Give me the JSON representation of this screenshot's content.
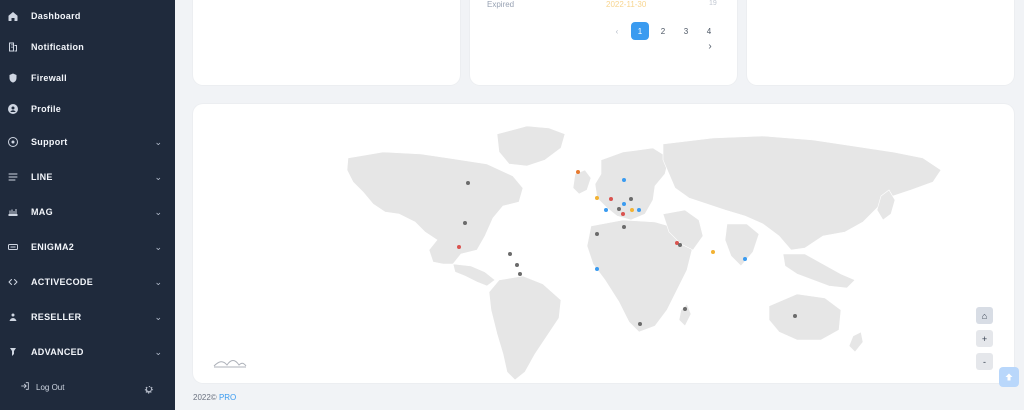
{
  "sidebar": {
    "items": [
      {
        "label": "Dashboard",
        "icon": "home-icon",
        "has_chevron": false
      },
      {
        "label": "Notification",
        "icon": "notification-icon",
        "has_chevron": false
      },
      {
        "label": "Firewall",
        "icon": "shield-icon",
        "has_chevron": false
      },
      {
        "label": "Profile",
        "icon": "profile-icon",
        "has_chevron": false
      },
      {
        "label": "Support",
        "icon": "support-icon",
        "has_chevron": true
      },
      {
        "label": "LINE",
        "icon": "line-icon",
        "has_chevron": true
      },
      {
        "label": "MAG",
        "icon": "mag-icon",
        "has_chevron": true
      },
      {
        "label": "ENIGMA2",
        "icon": "enigma-icon",
        "has_chevron": true
      },
      {
        "label": "ACTIVECODE",
        "icon": "activecode-icon",
        "has_chevron": true
      },
      {
        "label": "RESELLER",
        "icon": "reseller-icon",
        "has_chevron": true
      },
      {
        "label": "ADVANCED",
        "icon": "advanced-icon",
        "has_chevron": true
      }
    ],
    "logout_label": "Log Out"
  },
  "top_cards": {
    "middle": {
      "expired_label": "Expired",
      "faded_date": "2022-11-30",
      "faded_num": "19",
      "pagination": {
        "pages": [
          "1",
          "2",
          "3",
          "4"
        ],
        "active_page": "1",
        "prev_symbol": "‹",
        "next_symbol": "›"
      }
    }
  },
  "map": {
    "home_button": "⌂",
    "zoom_in": "+",
    "zoom_out": "-"
  },
  "footer": {
    "copyright": "2022©",
    "brand": "PRO"
  },
  "colors": {
    "accent": "#3a9bf0",
    "gold": "#f2b233",
    "sidebar": "#1f2a3c"
  }
}
